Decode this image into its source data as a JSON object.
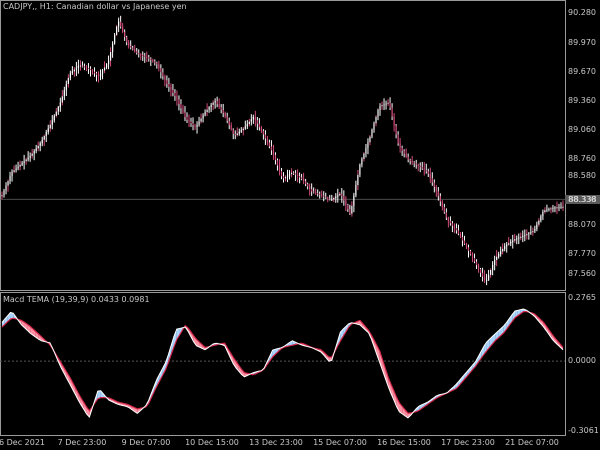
{
  "chart_title": "CADJPY,, H1:  Canadian dollar vs Japanese yen",
  "indicator_title": "Macd TEMA (19,39,9) 0.0433 0.0981",
  "current_price": "88.338",
  "colors": {
    "background": "#000000",
    "candle": "#ffffff",
    "candle_accent": "#d04a7a",
    "macd_up": "#a8d4ff",
    "macd_down": "#ff8fa3",
    "macd_line": "#ffffff",
    "signal_line": "#d2284a",
    "zero_line": "#555555",
    "frame": "#9a9a9a"
  },
  "chart_data": [
    {
      "type": "line",
      "title": "CADJPY,, H1:  Canadian dollar vs Japanese yen",
      "ylim": [
        87.4,
        90.4
      ],
      "y_ticks": [
        "90.280",
        "89.970",
        "89.670",
        "89.360",
        "89.060",
        "88.760",
        "88.580",
        "88.330",
        "88.070",
        "87.770",
        "87.560"
      ],
      "x_ticks": [
        "6 Dec 2021",
        "7 Dec 23:00",
        "9 Dec 07:00",
        "10 Dec 15:00",
        "13 Dec 23:00",
        "15 Dec 07:00",
        "16 Dec 15:00",
        "17 Dec 23:00",
        "21 Dec 07:00"
      ],
      "series": [
        {
          "values": [
            88.38,
            88.62,
            88.71,
            88.8,
            88.93,
            89.12,
            89.34,
            89.65,
            89.74,
            89.7,
            89.62,
            89.78,
            90.21,
            89.95,
            89.86,
            89.82,
            89.75,
            89.55,
            89.4,
            89.18,
            89.09,
            89.25,
            89.37,
            89.22,
            89.0,
            89.08,
            89.2,
            89.02,
            88.82,
            88.55,
            88.62,
            88.55,
            88.42,
            88.38,
            88.33,
            88.4,
            88.18,
            88.7,
            88.98,
            89.31,
            89.35,
            88.9,
            88.75,
            88.69,
            88.62,
            88.4,
            88.13,
            88.01,
            87.84,
            87.66,
            87.47,
            87.72,
            87.85,
            87.92,
            87.96,
            88.01,
            88.22,
            88.25,
            88.26
          ]
        }
      ]
    },
    {
      "type": "area",
      "title": "Macd TEMA (19,39,9) 0.0433 0.0981",
      "ylim": [
        -0.32,
        0.295
      ],
      "y_ticks": [
        "0.2765",
        "0.0000",
        "-0.3061"
      ],
      "x_ticks": [
        "6 Dec 2021",
        "7 Dec 23:00",
        "9 Dec 07:00",
        "10 Dec 15:00",
        "13 Dec 23:00",
        "15 Dec 07:00",
        "16 Dec 15:00",
        "17 Dec 23:00",
        "21 Dec 07:00"
      ],
      "series": [
        {
          "values": [
            0.17,
            0.22,
            0.16,
            0.12,
            0.09,
            0.08,
            -0.02,
            -0.1,
            -0.18,
            -0.25,
            -0.12,
            -0.17,
            -0.19,
            -0.2,
            -0.23,
            -0.19,
            -0.08,
            0.0,
            0.14,
            0.15,
            0.07,
            0.05,
            0.08,
            0.07,
            -0.02,
            -0.07,
            -0.05,
            -0.04,
            0.05,
            0.06,
            0.09,
            0.07,
            0.06,
            0.04,
            -0.01,
            0.13,
            0.17,
            0.16,
            0.12,
            0.0,
            -0.12,
            -0.22,
            -0.25,
            -0.2,
            -0.18,
            -0.15,
            -0.14,
            -0.1,
            -0.05,
            0.0,
            0.08,
            0.12,
            0.16,
            0.22,
            0.23,
            0.2,
            0.15,
            0.09,
            0.05
          ]
        },
        {
          "values": [
            0.15,
            0.19,
            0.18,
            0.15,
            0.11,
            0.07,
            0.0,
            -0.07,
            -0.15,
            -0.22,
            -0.16,
            -0.16,
            -0.18,
            -0.19,
            -0.21,
            -0.2,
            -0.11,
            -0.03,
            0.09,
            0.16,
            0.1,
            0.06,
            0.07,
            0.08,
            0.01,
            -0.05,
            -0.06,
            -0.04,
            0.02,
            0.06,
            0.07,
            0.08,
            0.06,
            0.05,
            0.01,
            0.09,
            0.16,
            0.18,
            0.13,
            0.05,
            -0.08,
            -0.18,
            -0.23,
            -0.22,
            -0.19,
            -0.16,
            -0.14,
            -0.12,
            -0.07,
            -0.02,
            0.04,
            0.09,
            0.13,
            0.19,
            0.22,
            0.21,
            0.17,
            0.11,
            0.06
          ]
        }
      ]
    }
  ]
}
